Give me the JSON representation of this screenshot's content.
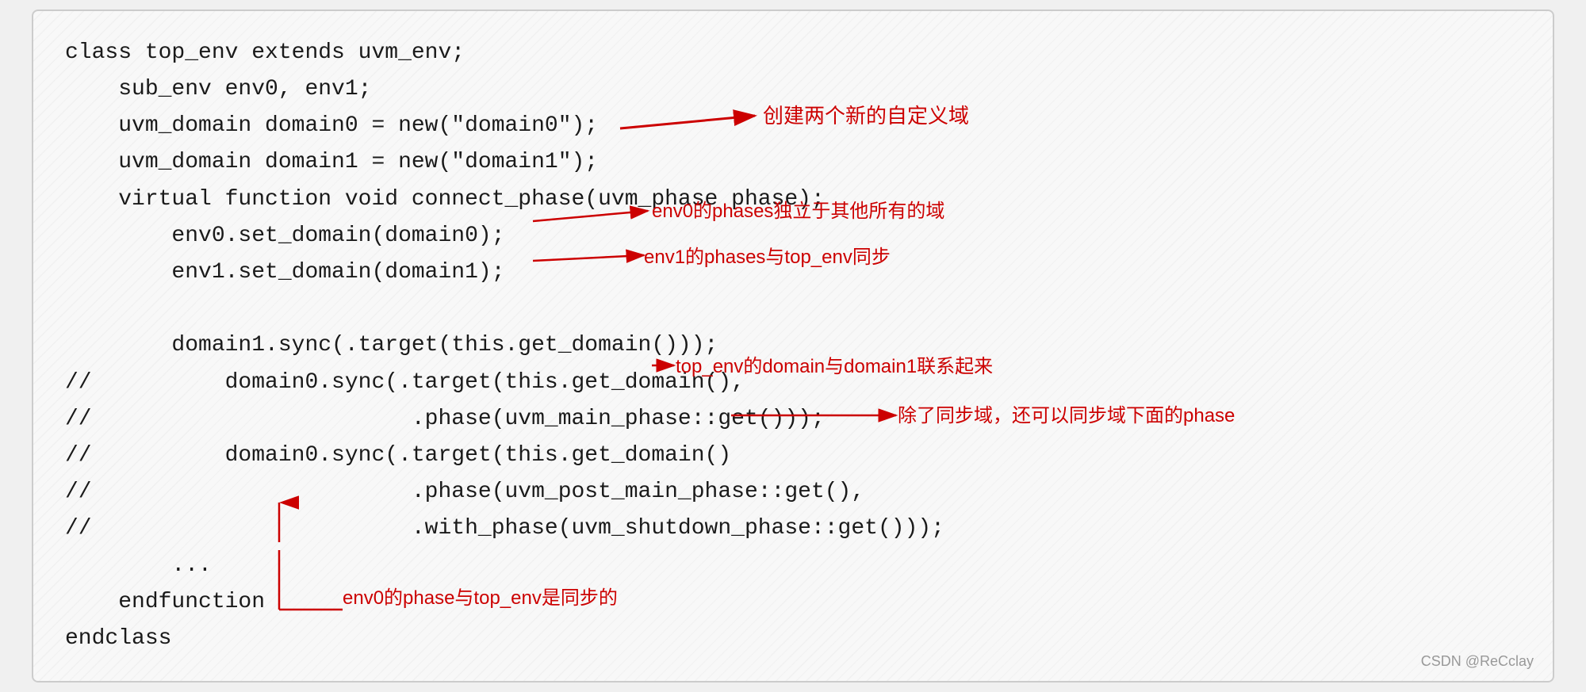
{
  "code": {
    "lines": [
      "class top_env extends uvm_env;",
      "    sub_env env0, env1;",
      "    uvm_domain domain0 = new(\"domain0\");",
      "    uvm_domain domain1 = new(\"domain1\");",
      "    virtual function void connect_phase(uvm_phase phase);",
      "        env0.set_domain(domain0);",
      "        env1.set_domain(domain1);",
      "",
      "        domain1.sync(.target(this.get_domain()));",
      "//          domain0.sync(.target(this.get_domain(),",
      "//                        .phase(uvm_main_phase::get()));",
      "//          domain0.sync(.target(this.get_domain()",
      "//                        .phase(uvm_post_main_phase::get(),",
      "//                        .with_phase(uvm_shutdown_phase::get()));",
      "        ...",
      "    endfunction",
      "endclass"
    ]
  },
  "annotations": {
    "create_domain": "创建两个新的自定义域",
    "env0_phases": "env0的phases独立于其他所有的域",
    "env1_phases": "env1的phases与top_env同步",
    "top_env_domain": "top_env的domain与domain1联系起来",
    "sync_phase": "除了同步域，还可以同步域下面的phase",
    "env0_sync": "env0的phase与top_env是同步的"
  },
  "watermark": "CSDN @ReCclay"
}
